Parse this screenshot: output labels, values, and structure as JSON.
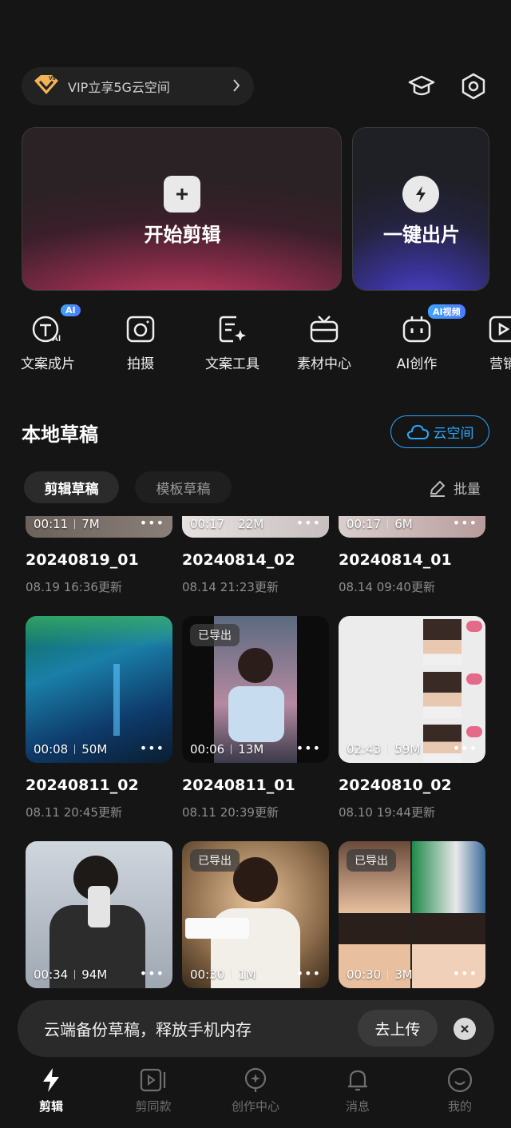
{
  "vip": {
    "label": "VIP立享5G云空间",
    "badge": "VIP"
  },
  "hero": {
    "main_label": "开始剪辑",
    "side_label": "一键出片"
  },
  "tools": [
    {
      "label": "文案成片",
      "badge": "AI",
      "icon": "text-ai-icon"
    },
    {
      "label": "拍摄",
      "badge": "",
      "icon": "camera-icon"
    },
    {
      "label": "文案工具",
      "badge": "",
      "icon": "text-tool-icon"
    },
    {
      "label": "素材中心",
      "badge": "",
      "icon": "material-icon"
    },
    {
      "label": "AI创作",
      "badge": "AI视频",
      "icon": "robot-icon"
    },
    {
      "label": "营销",
      "badge": "",
      "icon": "marketing-icon"
    }
  ],
  "section": {
    "title": "本地草稿",
    "cloud_label": "云空间"
  },
  "tabs": {
    "active": "剪辑草稿",
    "inactive": "模板草稿",
    "batch": "批量"
  },
  "drafts": [
    {
      "name": "20240819_01",
      "updated": "08.19 16:36更新",
      "duration": "00:11",
      "size": "7M",
      "exported": "",
      "palette": "#3a3330"
    },
    {
      "name": "20240814_02",
      "updated": "08.14 21:23更新",
      "duration": "00:17",
      "size": "22M",
      "exported": "",
      "palette": "#5a4a4a"
    },
    {
      "name": "20240814_01",
      "updated": "08.14 09:40更新",
      "duration": "00:17",
      "size": "6M",
      "exported": "",
      "palette": "#6a5858"
    },
    {
      "name": "20240811_02",
      "updated": "08.11 20:45更新",
      "duration": "00:08",
      "size": "50M",
      "exported": "",
      "palette": "stage"
    },
    {
      "name": "20240811_01",
      "updated": "08.11 20:39更新",
      "duration": "00:06",
      "size": "13M",
      "exported": "已导出",
      "palette": "concert"
    },
    {
      "name": "20240810_02",
      "updated": "08.10 19:44更新",
      "duration": "02:43",
      "size": "59M",
      "exported": "",
      "palette": "white"
    },
    {
      "name": "",
      "updated": "",
      "duration": "00:34",
      "size": "94M",
      "exported": "",
      "palette": "selfie"
    },
    {
      "name": "",
      "updated": "",
      "duration": "00:30",
      "size": "1M",
      "exported": "已导出",
      "palette": "singer"
    },
    {
      "name": "",
      "updated": "",
      "duration": "00:30",
      "size": "3M",
      "exported": "已导出",
      "palette": "collage"
    }
  ],
  "banner": {
    "text": "云端备份草稿，释放手机内存",
    "button": "去上传"
  },
  "nav": [
    {
      "label": "剪辑",
      "icon": "bolt-icon",
      "active": true
    },
    {
      "label": "剪同款",
      "icon": "template-icon",
      "active": false
    },
    {
      "label": "创作中心",
      "icon": "creator-icon",
      "active": false
    },
    {
      "label": "消息",
      "icon": "bell-icon",
      "active": false
    },
    {
      "label": "我的",
      "icon": "profile-icon",
      "active": false
    }
  ],
  "colors": {
    "accent": "#2aa8ff",
    "bg": "#151515"
  }
}
